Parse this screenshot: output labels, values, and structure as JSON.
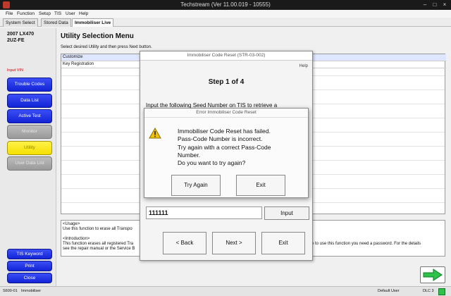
{
  "window": {
    "title": "Techstream (Ver 11.00.019 - 10555)"
  },
  "menu": [
    "File",
    "Function",
    "Setup",
    "TIS",
    "User",
    "Help"
  ],
  "tabs": [
    "System Select",
    "Stored Data",
    "Immobiliser Live"
  ],
  "vehicle": {
    "model": "2007 LX470",
    "engine": "2UZ-FE",
    "input_vin": "Input VIN"
  },
  "nav": {
    "trouble_codes": "Trouble Codes",
    "data_list": "Data List",
    "active_test": "Active Test",
    "monitor": "Monitor",
    "utility": "Utility",
    "user_data_list": "User Data List",
    "tis_keyword": "TIS Keyword",
    "print": "Print",
    "close": "Close"
  },
  "main": {
    "title": "Utility Selection Menu",
    "subtitle": "Select desired Utility and then press Next button.",
    "items": [
      "Customize",
      "Key Registration"
    ],
    "description": {
      "usage_label": "<Usage>",
      "usage_text": "Use this function to erase all Transpo",
      "intro_label": "<Introduction>",
      "intro_line1": "This function erases all registered Tra",
      "intro_line1_right": "e to use this function you need a password. For the details",
      "intro_line2": "see the repair manual or the Service B"
    }
  },
  "dialog_reset": {
    "title": "Immobiliser Code Reset (STR-03-002)",
    "help": "Help",
    "step": "Step 1 of 4",
    "instruction": "Input the following Seed Number on TIS to retrieve a",
    "seed_value": "111111",
    "input_button": "Input",
    "back_button": "< Back",
    "next_button": "Next >",
    "exit_button": "Exit"
  },
  "dialog_error": {
    "title": "Error Immobiliser Code Reset",
    "lines": [
      "Immobiliser Code Reset has failed.",
      "Pass-Code Number is incorrect.",
      "Try again with a correct Pass-Code",
      "Number.",
      "Do you want to try again?"
    ],
    "try_again_button": "Try Again",
    "exit_button": "Exit"
  },
  "status": {
    "left": "S600-01",
    "module": "Immobiliser",
    "user": "Default User",
    "dlc": "DLC 3"
  },
  "colors": {
    "nav_blue": "#1a2fe6",
    "utility_yellow": "#f4e000",
    "warn_yellow": "#f2c200"
  }
}
